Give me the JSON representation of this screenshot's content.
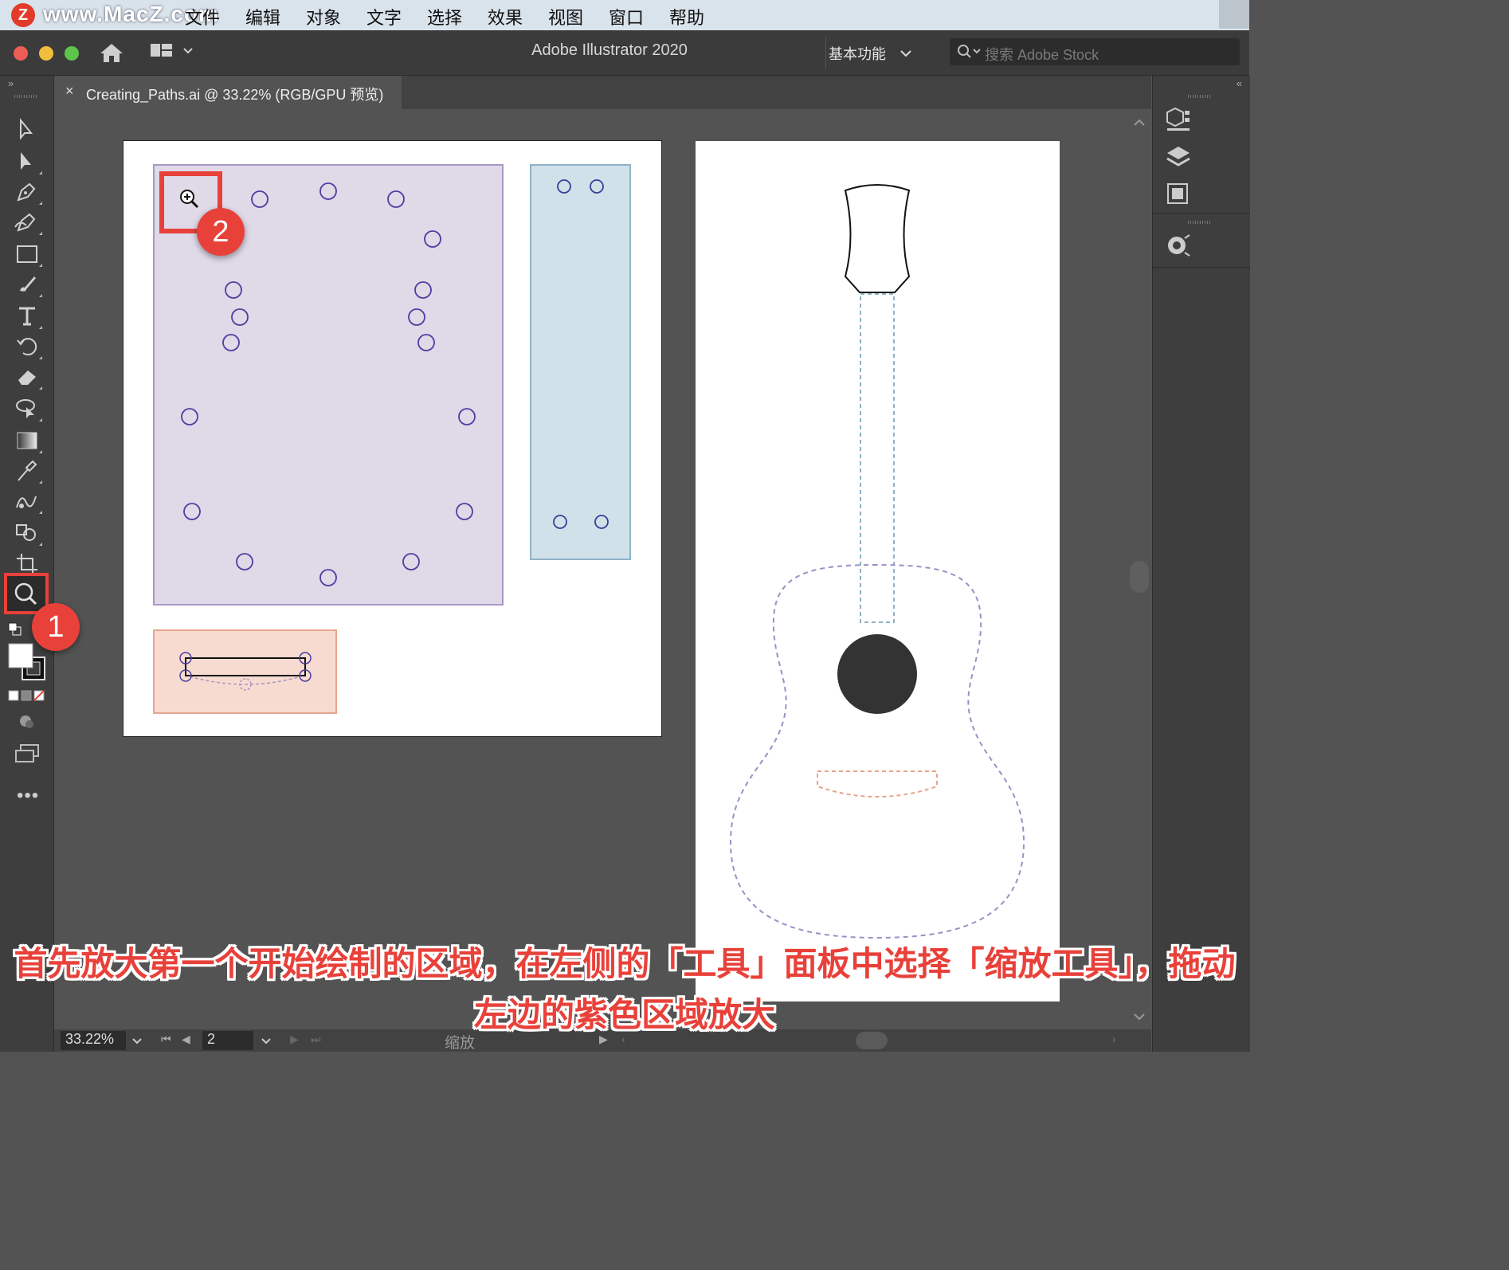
{
  "menubar": {
    "watermark": "www.MacZ.com",
    "items": [
      "文件",
      "编辑",
      "对象",
      "文字",
      "选择",
      "效果",
      "视图",
      "窗口",
      "帮助"
    ]
  },
  "titlebar": {
    "app_title": "Adobe Illustrator 2020",
    "workspace": "基本功能",
    "search_placeholder": "搜索 Adobe Stock"
  },
  "document_tab": {
    "close": "×",
    "title": "Creating_Paths.ai @ 33.22% (RGB/GPU 预览)"
  },
  "tools": [
    "selection-tool",
    "direct-selection-tool",
    "pen-tool",
    "curvature-tool",
    "rectangle-tool",
    "paintbrush-tool",
    "type-tool",
    "rotate-tool",
    "eraser-tool",
    "lasso-tool",
    "gradient-tool",
    "eyedropper-tool",
    "blend-tool",
    "shape-builder-tool",
    "artboard-tool",
    "zoom-tool"
  ],
  "badges": {
    "one": "1",
    "two": "2"
  },
  "statusbar": {
    "zoom": "33.22%",
    "artboard_number": "2",
    "current_tool": "缩放"
  },
  "caption": {
    "line1": "首先放大第一个开始绘制的区域，在左侧的「工具」面板中选择「缩放工具」，拖动",
    "line2": "左边的紫色区域放大"
  },
  "colors": {
    "accent_red": "#e8413a",
    "purple_region": "#dfd9e8",
    "blue_region": "#d0e1e9",
    "peach_region": "#f8dbd0"
  }
}
